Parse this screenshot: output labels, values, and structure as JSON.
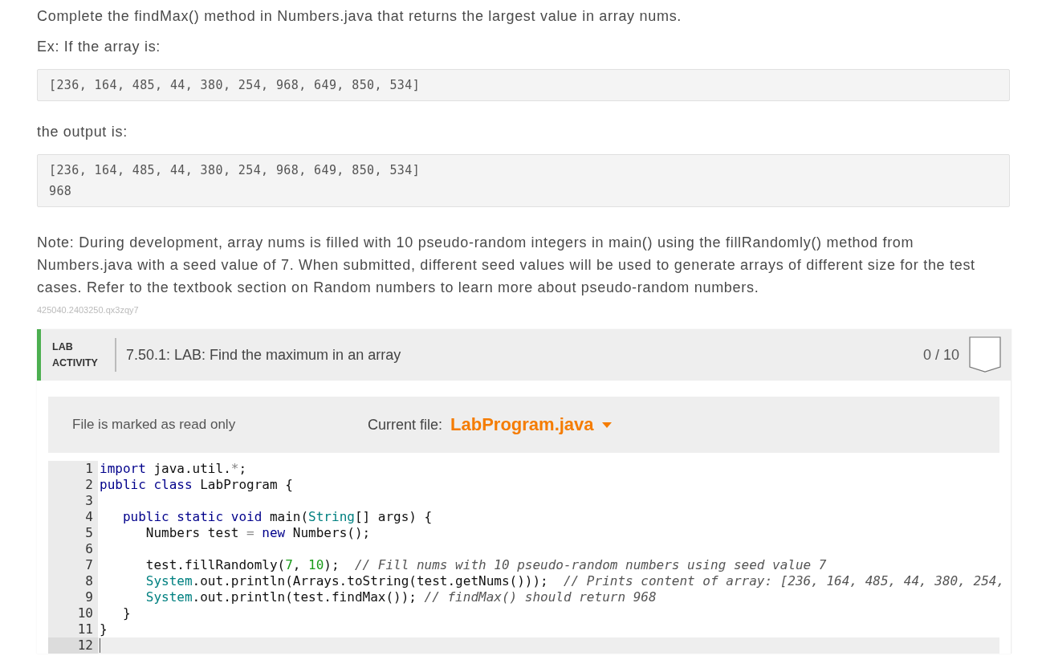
{
  "prompt": {
    "intro": "Complete the findMax() method in Numbers.java that returns the largest value in array nums.",
    "example_label": "Ex: If the array is:",
    "input_block": [
      "[236, 164, 485, 44, 380, 254, 968, 649, 850, 534]"
    ],
    "output_label": "the output is:",
    "output_block": [
      "[236, 164, 485, 44, 380, 254, 968, 649, 850, 534]",
      "968"
    ],
    "note": "Note: During development, array nums is filled with 10 pseudo-random integers in main() using the fillRandomly() method from Numbers.java with a seed value of 7. When submitted, different seed values will be used to generate arrays of different size for the test cases. Refer to the textbook section on Random numbers to learn more about pseudo-random numbers.",
    "id": "425040.2403250.qx3zqy7"
  },
  "lab": {
    "label": "LAB ACTIVITY",
    "title": "7.50.1: LAB: Find the maximum in an array",
    "score": "0 / 10",
    "editor": {
      "status": "File is marked as read only",
      "file_label": "Current file:",
      "file_name": "LabProgram.java",
      "lines": [
        {
          "number": "1",
          "selected": false,
          "tokens": [
            {
              "kind": "kw",
              "text": "import"
            },
            {
              "kind": "plain",
              "text": " java.util."
            },
            {
              "kind": "op",
              "text": "*"
            },
            {
              "kind": "plain",
              "text": ";"
            }
          ]
        },
        {
          "number": "2",
          "selected": false,
          "tokens": [
            {
              "kind": "kw",
              "text": "public class"
            },
            {
              "kind": "plain",
              "text": " LabProgram {"
            }
          ]
        },
        {
          "number": "3",
          "selected": false
        },
        {
          "number": "4",
          "selected": false,
          "tokens": [
            {
              "kind": "kw",
              "text": "   public static void"
            },
            {
              "kind": "plain",
              "text": " main("
            },
            {
              "kind": "type",
              "text": "String"
            },
            {
              "kind": "plain",
              "text": "[] args) {"
            }
          ]
        },
        {
          "number": "5",
          "selected": false,
          "tokens": [
            {
              "kind": "plain",
              "text": "      Numbers test "
            },
            {
              "kind": "op",
              "text": "="
            },
            {
              "kind": "kw",
              "text": " new"
            },
            {
              "kind": "plain",
              "text": " Numbers();"
            }
          ]
        },
        {
          "number": "6",
          "selected": false
        },
        {
          "number": "7",
          "selected": false,
          "tokens": [
            {
              "kind": "plain",
              "text": "      test.fillRandomly("
            },
            {
              "kind": "num",
              "text": "7"
            },
            {
              "kind": "plain",
              "text": ", "
            },
            {
              "kind": "num",
              "text": "10"
            },
            {
              "kind": "plain",
              "text": ");  "
            },
            {
              "kind": "comment",
              "text": "// Fill nums with 10 pseudo-random numbers using seed value 7"
            }
          ]
        },
        {
          "number": "8",
          "selected": false,
          "tokens": [
            {
              "kind": "type",
              "text": "      System"
            },
            {
              "kind": "plain",
              "text": ".out.println(Arrays.toString(test.getNums()));  "
            },
            {
              "kind": "comment",
              "text": "// Prints content of array: [236, 164, 485, 44, 380, 254,"
            }
          ]
        },
        {
          "number": "9",
          "selected": false,
          "tokens": [
            {
              "kind": "type",
              "text": "      System"
            },
            {
              "kind": "plain",
              "text": ".out.println(test.findMax()); "
            },
            {
              "kind": "comment",
              "text": "// findMax() should return 968"
            }
          ]
        },
        {
          "number": "10",
          "selected": false,
          "tokens": [
            {
              "kind": "plain",
              "text": "   }"
            }
          ]
        },
        {
          "number": "11",
          "selected": false,
          "tokens": [
            {
              "kind": "plain",
              "text": "}"
            }
          ]
        },
        {
          "number": "12",
          "selected": true
        }
      ]
    }
  }
}
